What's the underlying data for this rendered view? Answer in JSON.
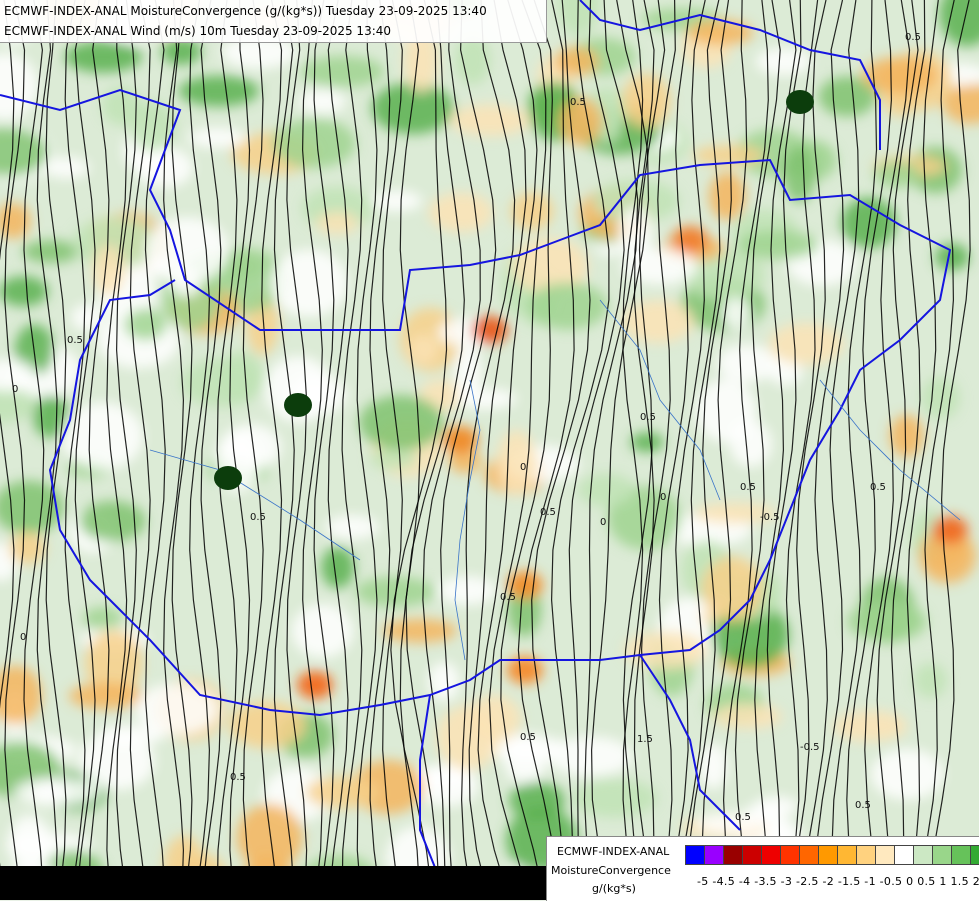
{
  "header": {
    "line1": "ECMWF-INDEX-ANAL MoistureConvergence (g/(kg*s)) Tuesday 23-09-2025 13:40",
    "line2": "ECMWF-INDEX-ANAL Wind (m/s) 10m Tuesday 23-09-2025 13:40"
  },
  "legend": {
    "model": "ECMWF-INDEX-ANAL",
    "variable": "MoistureConvergence",
    "unit": "g/(kg*s)",
    "tick_text": "-5 -4.5 -4 -3.5 -3 -2.5 -2 -1.5 -1 -0.5 0 0.5 1 1.5 2",
    "colors": [
      "#0000ff",
      "#9900ff",
      "#990000",
      "#cc0000",
      "#ee0000",
      "#ff3300",
      "#ff6600",
      "#ff9900",
      "#ffb733",
      "#ffd27f",
      "#ffe9bf",
      "#ffffff",
      "#cce8c4",
      "#99d68a",
      "#66c25a",
      "#33aa33",
      "#119911"
    ]
  },
  "map_labels": [
    "0",
    "0",
    "0.5",
    "0.5",
    "0",
    "0.5",
    "0",
    "0.5",
    "0.5",
    "0.5",
    "0",
    "-0.5",
    "0.5",
    "1.5",
    "0.5",
    "0.5",
    "0.5",
    "0.5",
    "-0.5",
    "0.5",
    "0.5"
  ]
}
